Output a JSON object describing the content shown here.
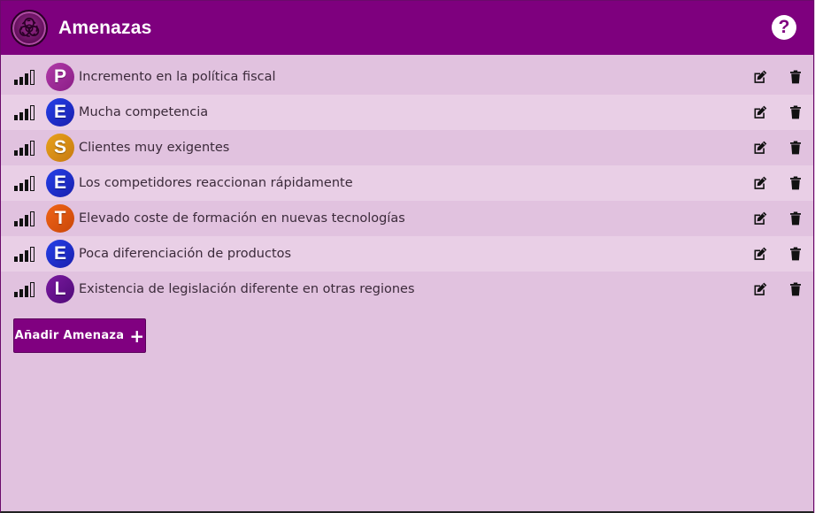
{
  "header": {
    "title": "Amenazas",
    "logo_icon": "biohazard-icon",
    "help_icon": "question-circle-icon",
    "help_symbol": "?"
  },
  "threats": [
    {
      "letter": "P",
      "text": "Incremento en la política fiscal",
      "badge_colors": [
        "#b03aa8",
        "#8a1d86"
      ],
      "signal_level": 3
    },
    {
      "letter": "E",
      "text": "Mucha competencia",
      "badge_colors": [
        "#2440e8",
        "#1a1fae"
      ],
      "signal_level": 3
    },
    {
      "letter": "S",
      "text": "Clientes muy exigentes",
      "badge_colors": [
        "#e8a21c",
        "#c77a10"
      ],
      "signal_level": 3
    },
    {
      "letter": "E",
      "text": "Los competidores reaccionan rápidamente",
      "badge_colors": [
        "#2440e8",
        "#1a1fae"
      ],
      "signal_level": 3
    },
    {
      "letter": "T",
      "text": "Elevado coste de formación en nuevas tecnologías",
      "badge_colors": [
        "#f06418",
        "#c94708"
      ],
      "signal_level": 3
    },
    {
      "letter": "E",
      "text": "Poca diferenciación de productos",
      "badge_colors": [
        "#2440e8",
        "#1a1fae"
      ],
      "signal_level": 3
    },
    {
      "letter": "L",
      "text": "Existencia de legislación diferente en otras regiones",
      "badge_colors": [
        "#7a1aa0",
        "#500a78"
      ],
      "signal_level": 3
    }
  ],
  "row_icons": {
    "edit": "edit-icon",
    "delete": "trash-icon"
  },
  "add_button": {
    "label": "Añadir Amenaza",
    "icon": "+"
  },
  "colors": {
    "accent": "#800080",
    "background": "#e1c2df",
    "row_alt": "#e9cfe6"
  }
}
